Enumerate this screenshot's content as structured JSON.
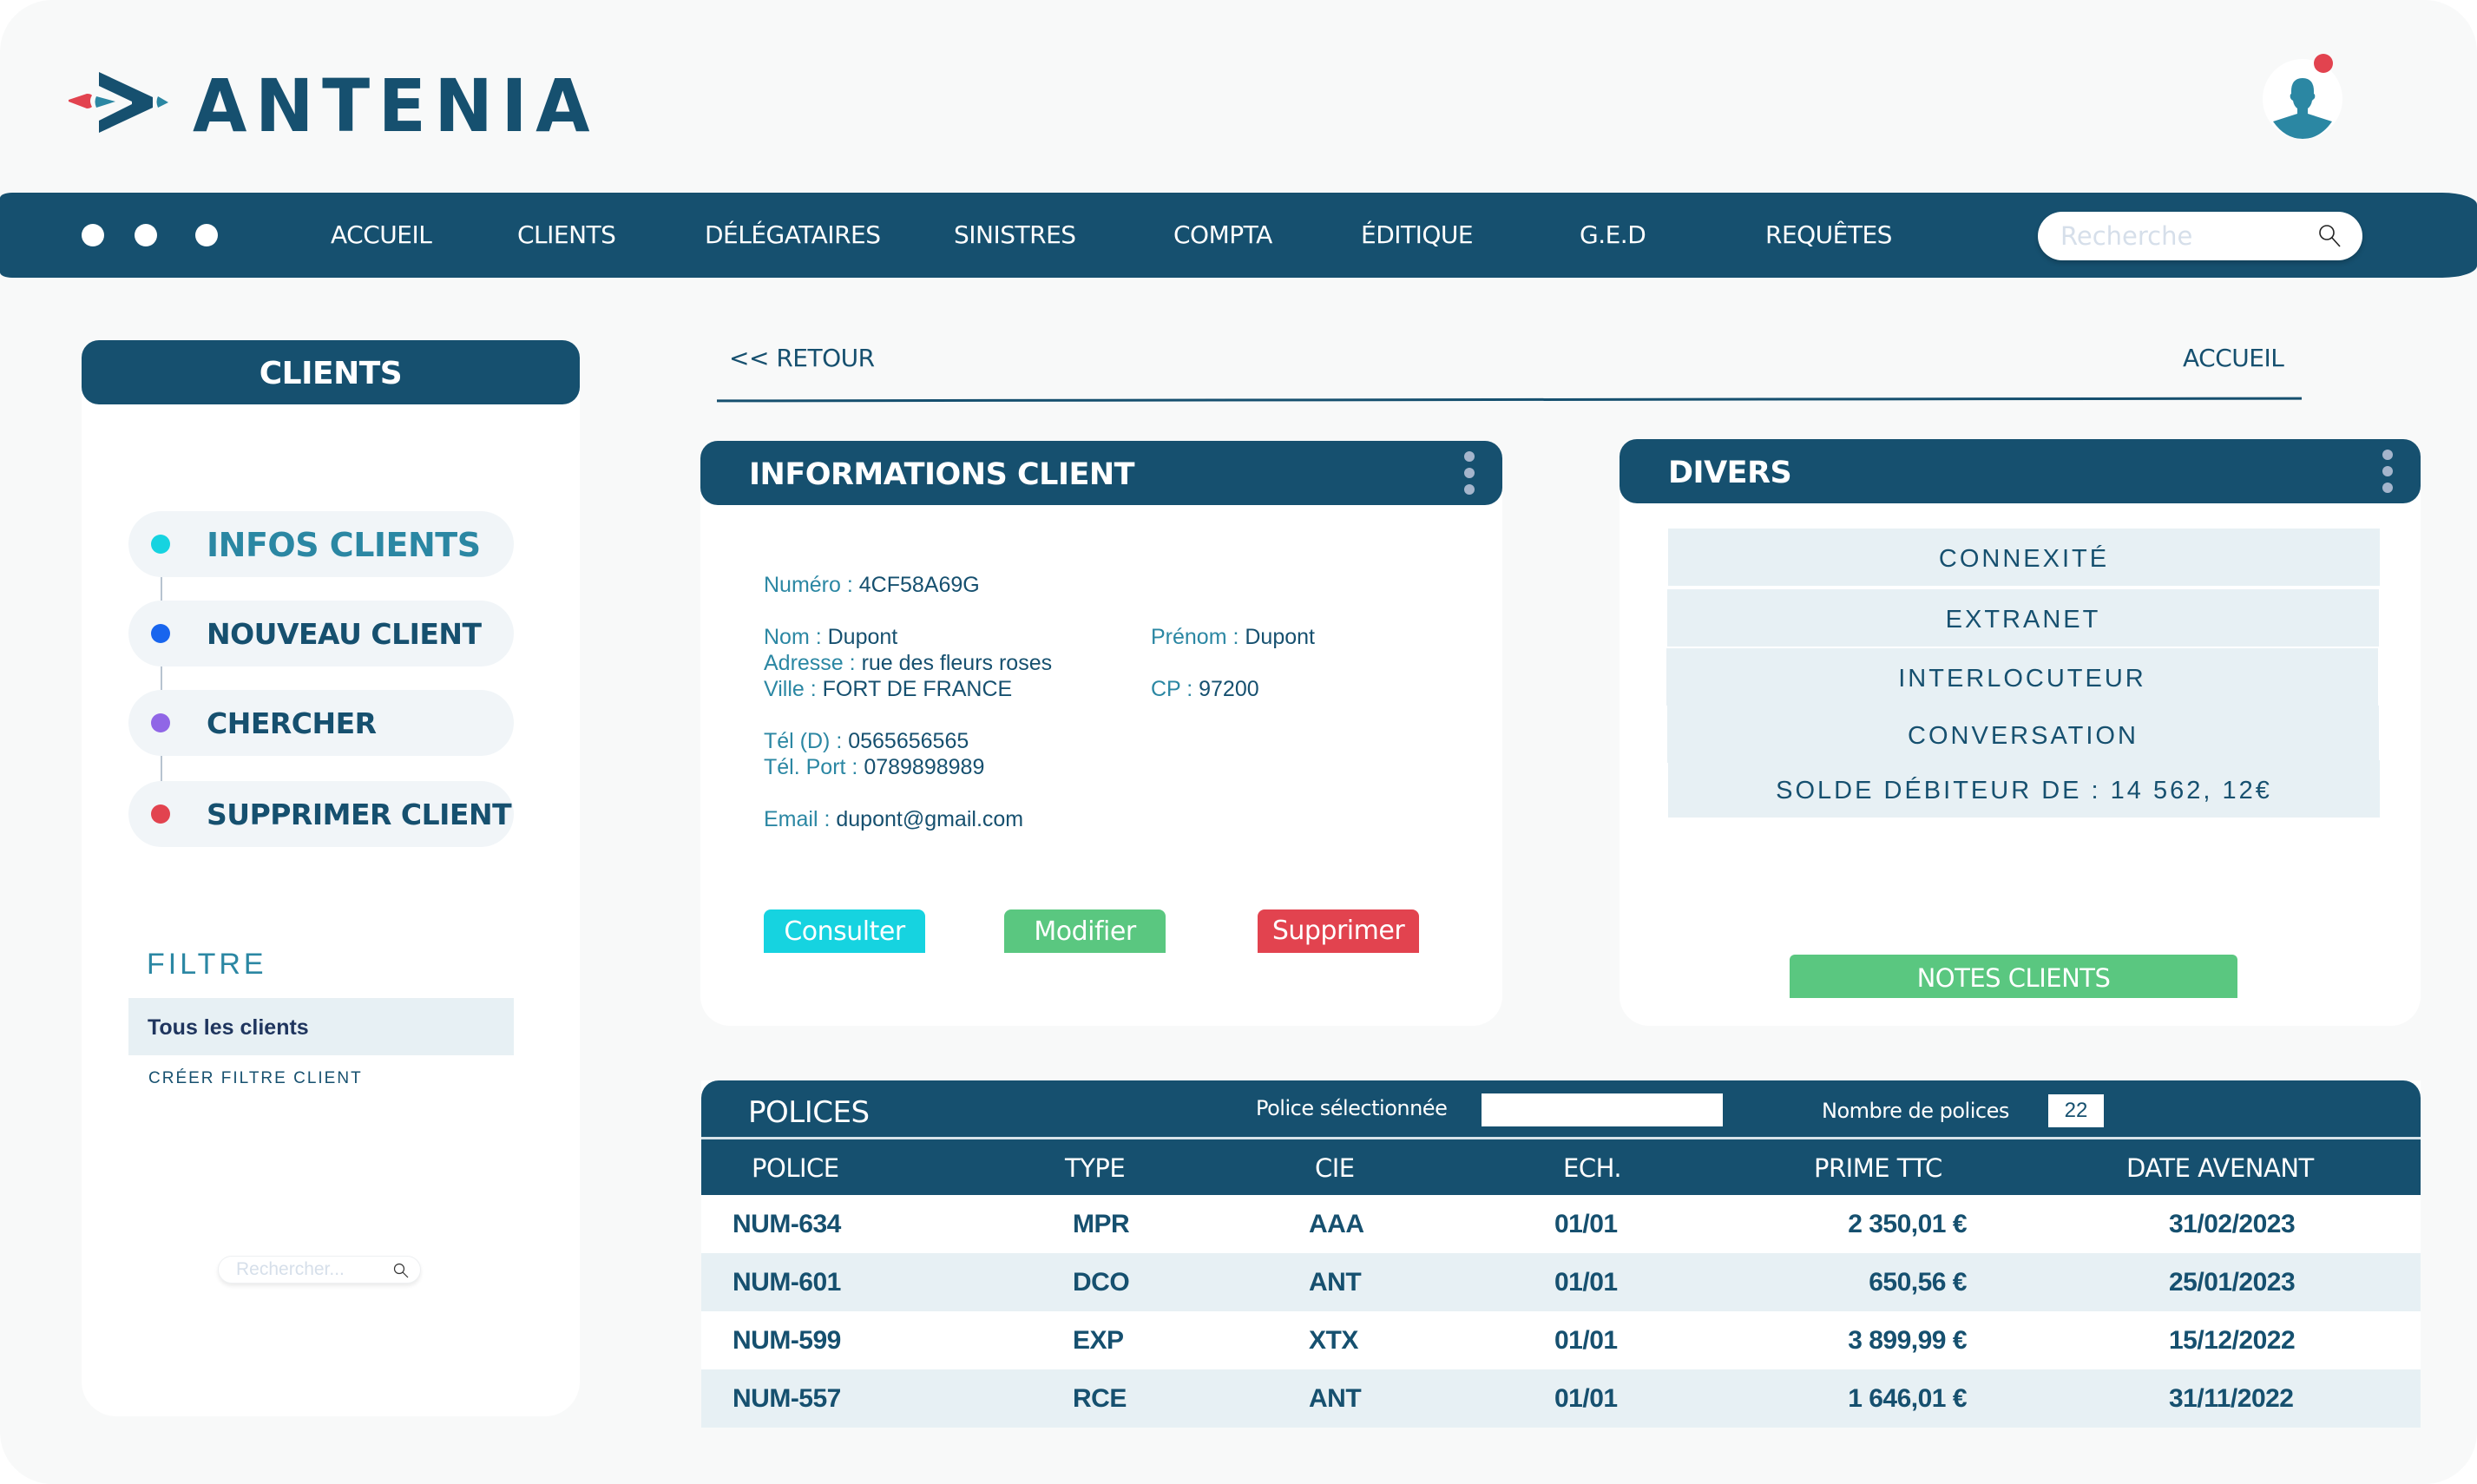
{
  "brand": {
    "name": "ANTENIA",
    "colors": {
      "primary": "#16506f",
      "accent": "#2b87a3",
      "red": "#e2434f"
    }
  },
  "user": {
    "avatar_icon": "user-silhouette-icon",
    "has_notification": true
  },
  "nav": {
    "items": [
      "ACCUEIL",
      "CLIENTS",
      "DÉLÉGATAIRES",
      "SINISTRES",
      "COMPTA",
      "ÉDITIQUE",
      "G.E.D",
      "REQUÊTES"
    ],
    "search_placeholder": "Recherche",
    "search_value": ""
  },
  "sidebar": {
    "title": "CLIENTS",
    "items": [
      {
        "label": "INFOS CLIENTS",
        "color": "#16d3e0",
        "active": true
      },
      {
        "label": "NOUVEAU CLIENT",
        "color": "#1865ee",
        "active": false
      },
      {
        "label": "CHERCHER",
        "color": "#9066e6",
        "active": false
      },
      {
        "label": "SUPPRIMER CLIENT",
        "color": "#e2434f",
        "active": false
      }
    ],
    "filter": {
      "title": "FILTRE",
      "selected": "Tous les clients",
      "create_label": "CRÉER FILTRE CLIENT"
    },
    "search_placeholder": "Rechercher..."
  },
  "breadcrumb": {
    "back": "<< RETOUR",
    "home": "ACCUEIL"
  },
  "client_info": {
    "title": "INFORMATIONS CLIENT",
    "fields": {
      "numero": {
        "label": "Numéro : ",
        "value": "4CF58A69G"
      },
      "nom": {
        "label": "Nom : ",
        "value": "Dupont"
      },
      "prenom": {
        "label": "Prénom : ",
        "value": "Dupont"
      },
      "adresse": {
        "label": "Adresse : ",
        "value": "rue des fleurs roses"
      },
      "ville": {
        "label": "Ville : ",
        "value": "FORT DE FRANCE"
      },
      "cp": {
        "label": "CP : ",
        "value": "97200"
      },
      "tel_d": {
        "label": "Tél (D) : ",
        "value": "0565656565"
      },
      "tel_port": {
        "label": "Tél. Port : ",
        "value": "0789898989"
      },
      "email": {
        "label": "Email : ",
        "value": "dupont@gmail.com"
      }
    },
    "buttons": {
      "consult": {
        "label": "Consulter",
        "color": "#16d3e0"
      },
      "modify": {
        "label": "Modifier",
        "color": "#5ac780"
      },
      "delete": {
        "label": "Supprimer",
        "color": "#e2434f"
      }
    }
  },
  "divers": {
    "title": "DIVERS",
    "items": [
      "CONNEXITÉ",
      "EXTRANET",
      "INTERLOCUTEUR",
      "CONVERSATION",
      "SOLDE DÉBITEUR DE : 14 562, 12€"
    ],
    "notes_label": "NOTES CLIENTS"
  },
  "polices": {
    "title": "POLICES",
    "selected_label": "Police sélectionnée",
    "selected_value": "",
    "count_label": "Nombre de polices",
    "count": "22",
    "columns": [
      "POLICE",
      "TYPE",
      "CIE",
      "ECH.",
      "PRIME TTC",
      "DATE AVENANT"
    ],
    "rows": [
      [
        "NUM-634",
        "MPR",
        "AAA",
        "01/01",
        "2 350,01 €",
        "31/02/2023"
      ],
      [
        "NUM-601",
        "DCO",
        "ANT",
        "01/01",
        "650,56 €",
        "25/01/2023"
      ],
      [
        "NUM-599",
        "EXP",
        "XTX",
        "01/01",
        "3 899,99 €",
        "15/12/2022"
      ],
      [
        "NUM-557",
        "RCE",
        "ANT",
        "01/01",
        "1 646,01 €",
        "31/11/2022"
      ]
    ]
  }
}
